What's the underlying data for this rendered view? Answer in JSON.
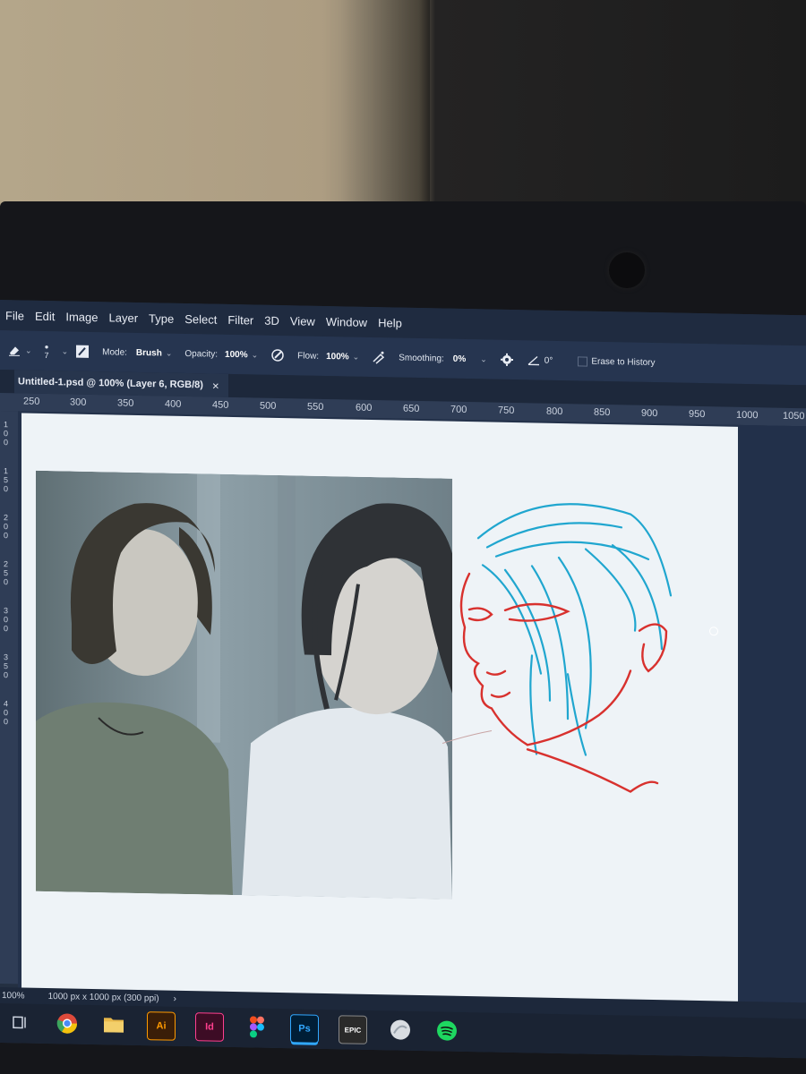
{
  "menu": [
    "File",
    "Edit",
    "Image",
    "Layer",
    "Type",
    "Select",
    "Filter",
    "3D",
    "View",
    "Window",
    "Help"
  ],
  "options": {
    "brush_size": "7",
    "mode_label": "Mode:",
    "mode_value": "Brush",
    "opacity_label": "Opacity:",
    "opacity_value": "100%",
    "flow_label": "Flow:",
    "flow_value": "100%",
    "smoothing_label": "Smoothing:",
    "smoothing_value": "0%",
    "angle_value": "0°",
    "erase_history_label": "Erase to History"
  },
  "document_tab": {
    "title": "Untitled-1.psd @ 100% (Layer 6, RGB/8)",
    "close": "×"
  },
  "ruler_h": [
    "250",
    "300",
    "350",
    "400",
    "450",
    "500",
    "550",
    "600",
    "650",
    "700",
    "750",
    "800",
    "850",
    "900",
    "950",
    "1000",
    "1050"
  ],
  "ruler_v": [
    "100",
    "150",
    "200",
    "250",
    "300",
    "350",
    "400"
  ],
  "status": {
    "zoom": "100%",
    "doc_size": "1000 px x 1000 px (300 ppi)",
    "arrow": "›"
  },
  "taskbar": {
    "illustrator_label": "Ai",
    "indesign_label": "Id",
    "photoshop_label": "Ps",
    "epic_label": "EPIC"
  },
  "colors": {
    "sketch_red": "#d8312e",
    "sketch_blue": "#20a6cf",
    "ps_accent": "#31a8ff"
  },
  "icons": [
    "eraser-icon",
    "brush-preset-icon",
    "pressure-opacity-icon",
    "airbrush-icon",
    "settings-gear-icon",
    "angle-icon",
    "task-view-icon",
    "chrome-icon",
    "file-explorer-icon",
    "figma-icon",
    "spotify-icon"
  ]
}
